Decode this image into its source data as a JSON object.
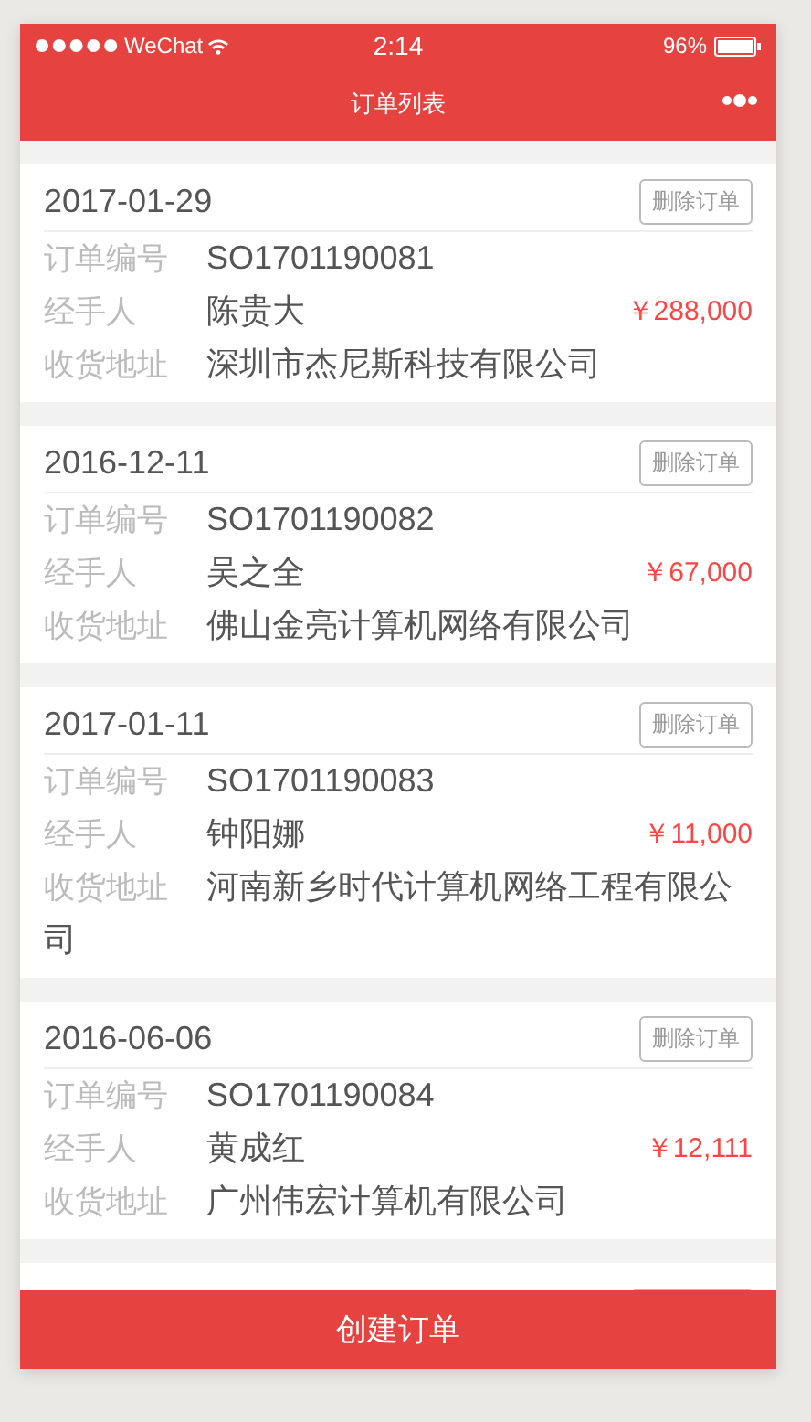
{
  "status_bar": {
    "carrier": "WeChat",
    "time": "2:14",
    "battery": "96%"
  },
  "nav": {
    "title": "订单列表"
  },
  "orders": [
    {
      "date": "2017-01-29",
      "delete": "删除订单",
      "order_no_label": "订单编号",
      "order_no": "SO1701190081",
      "handler_label": "经手人",
      "handler": "陈贵大",
      "amount": "￥288,000",
      "address_label": "收货地址",
      "address": "深圳市杰尼斯科技有限公司"
    },
    {
      "date": "2016-12-11",
      "delete": "删除订单",
      "order_no_label": "订单编号",
      "order_no": "SO1701190082",
      "handler_label": "经手人",
      "handler": "吴之全",
      "amount": "￥67,000",
      "address_label": "收货地址",
      "address": "佛山金亮计算机网络有限公司"
    },
    {
      "date": "2017-01-11",
      "delete": "删除订单",
      "order_no_label": "订单编号",
      "order_no": "SO1701190083",
      "handler_label": "经手人",
      "handler": "钟阳娜",
      "amount": "￥11,000",
      "address_label": "收货地址",
      "address": "河南新乡时代计算机网络工程有限公司"
    },
    {
      "date": "2016-06-06",
      "delete": "删除订单",
      "order_no_label": "订单编号",
      "order_no": "SO1701190084",
      "handler_label": "经手人",
      "handler": "黄成红",
      "amount": "￥12,111",
      "address_label": "收货地址",
      "address": "广州伟宏计算机有限公司"
    }
  ],
  "more_below": true,
  "create_button": "创建订单"
}
